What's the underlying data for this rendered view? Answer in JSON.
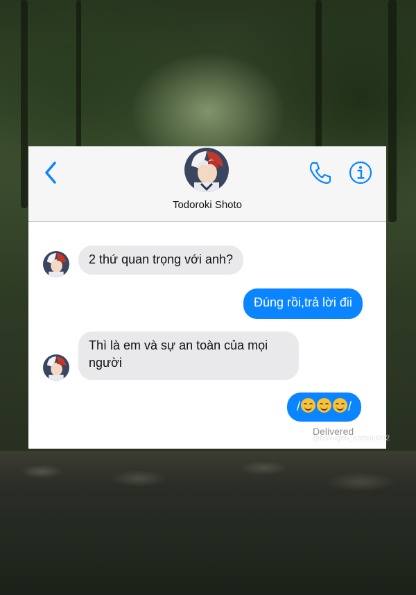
{
  "contact": {
    "name": "Todoroki Shoto"
  },
  "header": {
    "back_icon": "chevron-left-icon",
    "call_icon": "phone-icon",
    "info_icon": "info-icon",
    "accent_color": "#0a84ff"
  },
  "messages": [
    {
      "direction": "incoming",
      "text": "2 thứ quan trọng với anh?"
    },
    {
      "direction": "outgoing",
      "text": "Đúng rồi,trả lời đii"
    },
    {
      "direction": "incoming",
      "text": "Thì là em và sự an toàn của mọi người"
    },
    {
      "direction": "outgoing",
      "text_before": "/",
      "emoji_count": 3,
      "emoji": "smiling-face-icon",
      "text_after": "/"
    }
  ],
  "status": {
    "delivered": "Delivered"
  },
  "watermark": "@bakugou_katsuki092"
}
